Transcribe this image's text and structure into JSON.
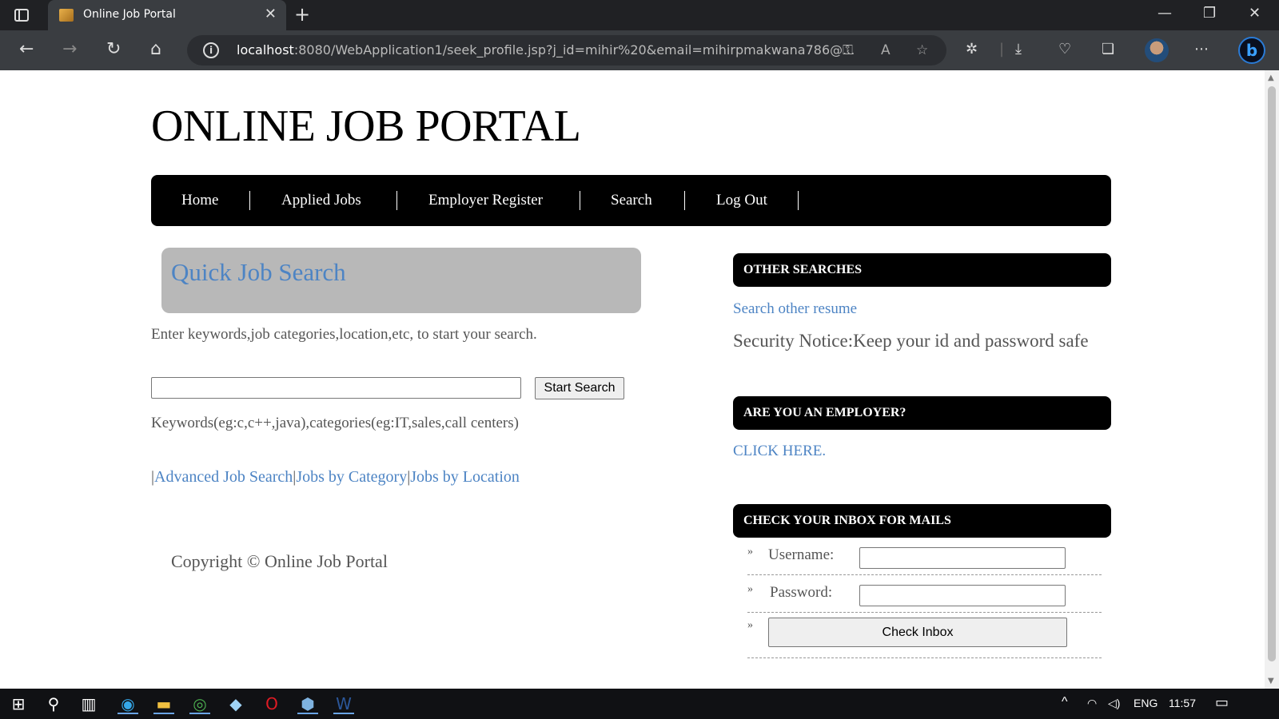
{
  "browser": {
    "tab_title": "Online Job Portal",
    "url_host": "localhost",
    "url_rest": ":8080/WebApplication1/seek_profile.jsp?j_id=mihir%20&email=mihirpmakwana786@..."
  },
  "site": {
    "title": "ONLINE JOB PORTAL",
    "menu": [
      "Home",
      "Applied Jobs",
      "Employer Register",
      "Search",
      "Log Out"
    ]
  },
  "quick_search": {
    "heading": "Quick Job Search",
    "intro": "Enter keywords,job categories,location,etc, to start your search.",
    "button": "Start Search",
    "input_value": "",
    "hint": "Keywords(eg:c,c++,java),categories(eg:IT,sales,call centers)",
    "links": [
      "Advanced Job Search",
      "Jobs by Category",
      "Jobs by Location"
    ],
    "separator": "|"
  },
  "footer": {
    "copyright": "Copyright © Online Job Portal"
  },
  "sidebar": {
    "other_searches_title": "OTHER SEARCHES",
    "search_resume_link": "Search other resume",
    "security_notice": "Security Notice:Keep your id and password safe",
    "employer_title": "ARE YOU AN EMPLOYER?",
    "employer_link": "CLICK HERE.",
    "inbox_title": "CHECK YOUR INBOX FOR MAILS",
    "username_label": "Username:",
    "password_label": "Password:",
    "username_value": "",
    "password_value": "",
    "check_button": "Check Inbox",
    "bullet": "»"
  },
  "taskbar": {
    "language": "ENG",
    "time": "11:57"
  }
}
